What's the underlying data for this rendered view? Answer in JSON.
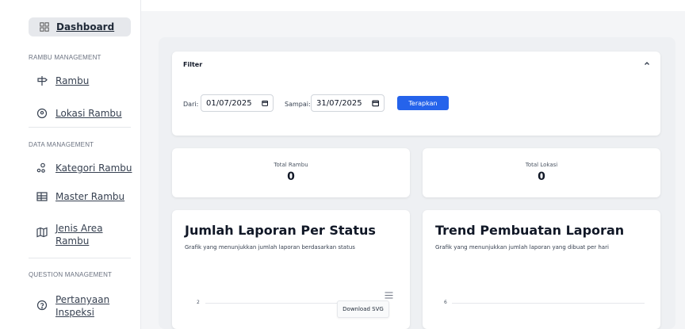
{
  "sidebar": {
    "dashboard_label": "Dashboard",
    "sections": [
      {
        "title": "RAMBU MANAGEMENT",
        "items": [
          {
            "label": "Rambu",
            "icon": "signpost-icon"
          },
          {
            "label": "Lokasi Rambu",
            "icon": "map-pin-icon"
          }
        ]
      },
      {
        "title": "DATA MANAGEMENT",
        "items": [
          {
            "label": "Kategori Rambu",
            "icon": "shapes-icon"
          },
          {
            "label": "Master Rambu",
            "icon": "table-icon"
          },
          {
            "label": "Jenis Area Rambu",
            "label_line1": "Jenis Area",
            "label_line2": "Rambu",
            "icon": "map-icon"
          }
        ]
      },
      {
        "title": "QUESTION MANAGEMENT",
        "items": [
          {
            "label": "Pertanyaan Inspeksi",
            "label_line1": "Pertanyaan",
            "label_line2": "Inspeksi",
            "icon": "help-circle-icon"
          }
        ]
      }
    ]
  },
  "filter": {
    "title": "Filter",
    "from_label": "Dari:",
    "from_value": "01/07/2025",
    "to_label": "Sampai:",
    "to_value": "31/07/2025",
    "apply_label": "Terapkan"
  },
  "stats": [
    {
      "label": "Total Rambu",
      "value": "0"
    },
    {
      "label": "Total Lokasi",
      "value": "0"
    }
  ],
  "charts": [
    {
      "title": "Jumlah Laporan Per Status",
      "subtitle": "Grafik yang menunjukkan jumlah laporan berdasarkan status",
      "ytick_top": "2",
      "menu_tooltip": "Download SVG"
    },
    {
      "title": "Trend Pembuatan Laporan",
      "subtitle": "Grafik yang menunjukkan jumlah laporan yang dibuat per hari",
      "ytick_top": "6"
    }
  ],
  "colors": {
    "accent": "#2563eb",
    "sidebar_active_bg": "#e6e8ec",
    "main_bg": "#f4f5f7"
  }
}
